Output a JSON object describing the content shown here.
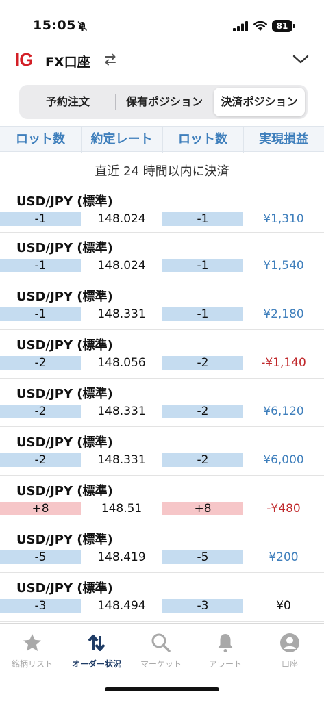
{
  "status": {
    "time": "15:05",
    "battery": "81"
  },
  "header": {
    "logo": "IG",
    "title": "FX口座"
  },
  "segments": [
    "予約注文",
    "保有ポジション",
    "決済ポジション"
  ],
  "columns": [
    "ロット数",
    "約定レート",
    "ロット数",
    "実現損益"
  ],
  "section_title": "直近 24 時間以内に決済",
  "rows": [
    {
      "pair": "USD/JPY (標準)",
      "lot_open": "-1",
      "rate": "148.024",
      "lot_close": "-1",
      "pnl": "¥1,310"
    },
    {
      "pair": "USD/JPY (標準)",
      "lot_open": "-1",
      "rate": "148.024",
      "lot_close": "-1",
      "pnl": "¥1,540"
    },
    {
      "pair": "USD/JPY (標準)",
      "lot_open": "-1",
      "rate": "148.331",
      "lot_close": "-1",
      "pnl": "¥2,180"
    },
    {
      "pair": "USD/JPY (標準)",
      "lot_open": "-2",
      "rate": "148.056",
      "lot_close": "-2",
      "pnl": "-¥1,140"
    },
    {
      "pair": "USD/JPY (標準)",
      "lot_open": "-2",
      "rate": "148.331",
      "lot_close": "-2",
      "pnl": "¥6,120"
    },
    {
      "pair": "USD/JPY (標準)",
      "lot_open": "-2",
      "rate": "148.331",
      "lot_close": "-2",
      "pnl": "¥6,000"
    },
    {
      "pair": "USD/JPY (標準)",
      "lot_open": "+8",
      "rate": "148.51",
      "lot_close": "+8",
      "pnl": "-¥480"
    },
    {
      "pair": "USD/JPY (標準)",
      "lot_open": "-5",
      "rate": "148.419",
      "lot_close": "-5",
      "pnl": "¥200"
    },
    {
      "pair": "USD/JPY (標準)",
      "lot_open": "-3",
      "rate": "148.494",
      "lot_close": "-3",
      "pnl": "¥0"
    }
  ],
  "colors": {
    "brand_red": "#d31f26",
    "accent_blue": "#3f7fbc",
    "loss_red": "#c0282b",
    "short_lot_bg": "#c5dcf0",
    "long_lot_bg": "#f6c6c8",
    "nav_active": "#1f3c66"
  },
  "tabbar": [
    {
      "label": "銘柄リスト",
      "icon": "star-icon"
    },
    {
      "label": "オーダー状況",
      "icon": "order-arrows-icon",
      "active": true
    },
    {
      "label": "マーケット",
      "icon": "search-icon"
    },
    {
      "label": "アラート",
      "icon": "bell-icon"
    },
    {
      "label": "口座",
      "icon": "account-icon"
    }
  ]
}
